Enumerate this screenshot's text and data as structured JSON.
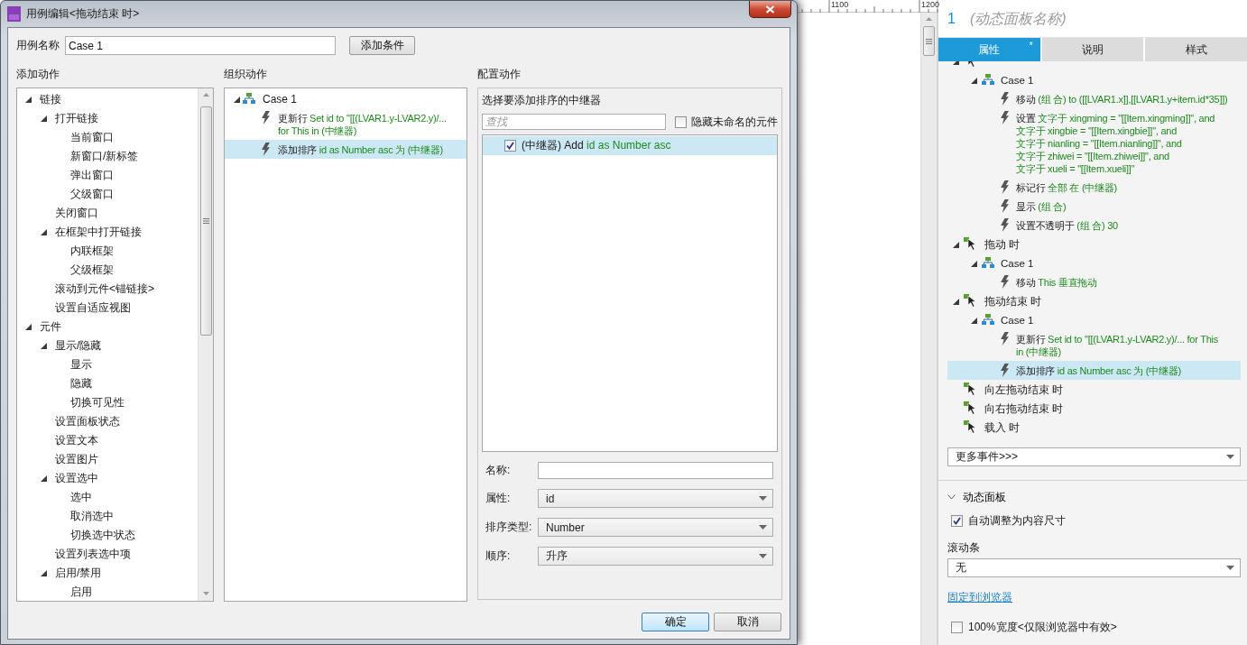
{
  "dialog": {
    "title": "用例编辑<拖动结束 时>",
    "case_name_label": "用例名称",
    "case_name": "Case 1",
    "add_condition_button": "添加条件",
    "add_actions": {
      "title": "添加动作",
      "tree": [
        {
          "label": "链接",
          "expanded": true,
          "children": [
            {
              "label": "打开链接",
              "expanded": true,
              "children": [
                {
                  "label": "当前窗口"
                },
                {
                  "label": "新窗口/新标签"
                },
                {
                  "label": "弹出窗口"
                },
                {
                  "label": "父级窗口"
                }
              ]
            },
            {
              "label": "关闭窗口"
            },
            {
              "label": "在框架中打开链接",
              "expanded": true,
              "children": [
                {
                  "label": "内联框架"
                },
                {
                  "label": "父级框架"
                }
              ]
            },
            {
              "label": "滚动到元件<锚链接>"
            },
            {
              "label": "设置自适应视图"
            }
          ]
        },
        {
          "label": "元件",
          "expanded": true,
          "children": [
            {
              "label": "显示/隐藏",
              "expanded": true,
              "children": [
                {
                  "label": "显示"
                },
                {
                  "label": "隐藏"
                },
                {
                  "label": "切换可见性"
                }
              ]
            },
            {
              "label": "设置面板状态"
            },
            {
              "label": "设置文本"
            },
            {
              "label": "设置图片"
            },
            {
              "label": "设置选中",
              "expanded": true,
              "children": [
                {
                  "label": "选中"
                },
                {
                  "label": "取消选中"
                },
                {
                  "label": "切换选中状态"
                }
              ]
            },
            {
              "label": "设置列表选中项"
            },
            {
              "label": "启用/禁用",
              "expanded": true,
              "children": [
                {
                  "label": "启用"
                }
              ]
            }
          ]
        }
      ]
    },
    "organize_actions": {
      "title": "组织动作",
      "tree": [
        {
          "kind": "case",
          "label": "Case 1",
          "expanded": true,
          "selected": false,
          "children": [
            {
              "kind": "action",
              "verb": "更新行",
              "detail": [
                "Set id to \"[[(LVAR1.y-LVAR2.y)/...",
                "for This in (中继器)"
              ],
              "selected": false
            },
            {
              "kind": "action",
              "verb": "添加排序",
              "detail": [
                "id as Number asc 为 (中继器)"
              ],
              "selected": true
            }
          ]
        }
      ]
    },
    "configure_action": {
      "title": "配置动作",
      "target_label": "选择要添加排序的中继器",
      "search_placeholder": "查找",
      "hide_unnamed": {
        "label": "隐藏未命名的元件",
        "checked": false
      },
      "targets": [
        {
          "name": "(中继器) Add",
          "detail": "id as Number asc",
          "checked": true,
          "selected": true
        }
      ],
      "fields": [
        {
          "kind": "text",
          "label": "名称:"
        },
        {
          "kind": "select",
          "label": "属性:",
          "value": "id"
        },
        {
          "kind": "select",
          "label": "排序类型:",
          "value": "Number"
        },
        {
          "kind": "select",
          "label": "顺序:",
          "value": "升序"
        }
      ]
    },
    "buttons": [
      {
        "label": "确定",
        "primary": true
      },
      {
        "label": "取消",
        "primary": false
      }
    ]
  },
  "canvas": {
    "ruler_labels": [
      "1100",
      "1200"
    ]
  },
  "panel": {
    "index": "1",
    "name_placeholder": "(动态面板名称)",
    "tabs": [
      {
        "label": "属性",
        "selected": true,
        "badge": "*"
      },
      {
        "label": "说明",
        "selected": false
      },
      {
        "label": "样式",
        "selected": false
      }
    ],
    "interactions": [
      {
        "kind": "event",
        "expanded": true,
        "children": [
          {
            "kind": "case",
            "label": "Case 1",
            "expanded": true,
            "children": [
              {
                "kind": "action",
                "verb": "移动",
                "detail": [
                  "(组 合) to ([[LVAR1.x]],[[LVAR1.y+item.id*35]])"
                ],
                "selected": false
              },
              {
                "kind": "action",
                "verb": "设置",
                "detail": [
                  "文字于 xingming = \"[[Item.xingming]]\", and",
                  "文字于 xingbie = \"[[Item.xingbie]]\", and",
                  "文字于 nianling = \"[[Item.nianling]]\", and",
                  "文字于 zhiwei = \"[[Item.zhiwei]]\", and",
                  "文字于 xueli = \"[[Item.xueli]]\""
                ],
                "selected": false
              },
              {
                "kind": "action",
                "verb": "标记行",
                "detail": [
                  "全部 在 (中继器)"
                ],
                "selected": false
              },
              {
                "kind": "action",
                "verb": "显示",
                "detail": [
                  "(组 合)"
                ],
                "selected": false
              },
              {
                "kind": "action",
                "verb": "设置不透明于",
                "detail": [
                  "(组 合) 30"
                ],
                "selected": false
              }
            ]
          }
        ]
      },
      {
        "kind": "event",
        "label": "拖动 时",
        "expanded": true,
        "children": [
          {
            "kind": "case",
            "label": "Case 1",
            "expanded": true,
            "children": [
              {
                "kind": "action",
                "verb": "移动",
                "detail": [
                  "This 垂直拖动"
                ],
                "selected": false
              }
            ]
          }
        ]
      },
      {
        "kind": "event",
        "label": "拖动结束 时",
        "expanded": true,
        "children": [
          {
            "kind": "case",
            "label": "Case 1",
            "expanded": true,
            "children": [
              {
                "kind": "action",
                "verb": "更新行",
                "detail": [
                  "Set id to \"[[(LVAR1.y-LVAR2.y)/... for This",
                  "in (中继器)"
                ],
                "selected": false
              },
              {
                "kind": "action",
                "verb": "添加排序",
                "detail": [
                  "id as Number asc 为 (中继器)"
                ],
                "selected": true
              }
            ]
          }
        ]
      },
      {
        "kind": "event",
        "label": "向左拖动结束 时"
      },
      {
        "kind": "event",
        "label": "向右拖动结束 时"
      },
      {
        "kind": "event",
        "label": "载入 时"
      }
    ],
    "more_events": "更多事件>>>",
    "section": {
      "title": "动态面板",
      "expanded": true
    },
    "auto_fit": {
      "label": "自动调整为内容尺寸",
      "checked": true
    },
    "scrollbars": {
      "label": "滚动条",
      "value": "无"
    },
    "pin_link": "固定到浏览器",
    "full_width": {
      "label": "100%宽度<仅限浏览器中有效>",
      "checked": false
    }
  }
}
